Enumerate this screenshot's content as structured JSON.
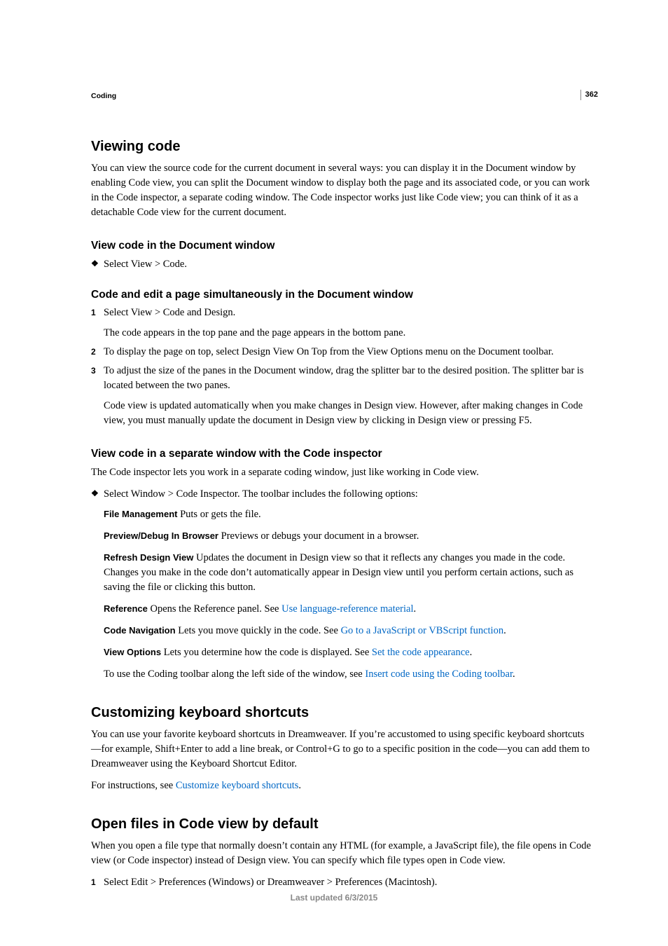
{
  "pageNumber": "362",
  "sectionLabel": "Coding",
  "h2_viewing": "Viewing code",
  "intro_viewing": "You can view the source code for the current document in several ways: you can display it in the Document window by enabling Code view, you can split the Document window to display both the page and its associated code, or you can work in the Code inspector, a separate coding window. The Code inspector works just like Code view; you can think of it as a detachable Code view for the current document.",
  "h3_docwin": "View code in the Document window",
  "docwin_bullet": "Select View > Code.",
  "h3_simul": "Code and edit a page simultaneously in the Document window",
  "simul_steps": [
    {
      "n": "1",
      "text": "Select View > Code and Design.",
      "after": "The code appears in the top pane and the page appears in the bottom pane."
    },
    {
      "n": "2",
      "text": "To display the page on top, select Design View On Top from the View Options menu on the Document toolbar."
    },
    {
      "n": "3",
      "text": "To adjust the size of the panes in the Document window, drag the splitter bar to the desired position. The splitter bar is located between the two panes.",
      "after": "Code view is updated automatically when you make changes in Design view. However, after making changes in Code view, you must manually update the document in Design view by clicking in Design view or pressing F5."
    }
  ],
  "h3_inspector": "View code in a separate window with the Code inspector",
  "inspector_intro": "The Code inspector lets you work in a separate coding window, just like working in Code view.",
  "inspector_bullet": "Select Window > Code Inspector. The toolbar includes the following options:",
  "defs": {
    "file_mgmt_term": "File Management",
    "file_mgmt_text": "  Puts or gets the file.",
    "preview_term": "Preview/Debug In Browser",
    "preview_text": "  Previews or debugs your document in a browser.",
    "refresh_term": "Refresh Design View",
    "refresh_text": "  Updates the document in Design view so that it reflects any changes you made in the code. Changes you make in the code don’t automatically appear in Design view until you perform certain actions, such as saving the file or clicking this button.",
    "reference_term": "Reference",
    "reference_pre": "  Opens the Reference panel. See ",
    "reference_link": "Use language-reference material",
    "codenav_term": "Code Navigation",
    "codenav_pre": "  Lets you move quickly in the code. See ",
    "codenav_link": "Go to a JavaScript or VBScript function",
    "viewopts_term": "View Options",
    "viewopts_pre": "  Lets you determine how the code is displayed. See ",
    "viewopts_link": "Set the code appearance",
    "toolbar_pre": "To use the Coding toolbar along the left side of the window, see ",
    "toolbar_link": "Insert code using the Coding toolbar"
  },
  "h2_shortcuts": "Customizing keyboard shortcuts",
  "shortcuts_p1": "You can use your favorite keyboard shortcuts in Dreamweaver. If you’re accustomed to using specific keyboard shortcuts—for example, Shift+Enter to add a line break, or Control+G to go to a specific position in the code—you can add them to Dreamweaver using the Keyboard Shortcut Editor.",
  "shortcuts_pre": "For instructions, see ",
  "shortcuts_link": "Customize keyboard shortcuts",
  "h2_openfiles": "Open files in Code view by default",
  "openfiles_intro": "When you open a file type that normally doesn’t contain any HTML (for example, a JavaScript file), the file opens in Code view (or Code inspector) instead of Design view. You can specify which file types open in Code view.",
  "openfiles_step1": "Select Edit > Preferences (Windows) or Dreamweaver > Preferences (Macintosh).",
  "footer": "Last updated 6/3/2015",
  "period": "."
}
